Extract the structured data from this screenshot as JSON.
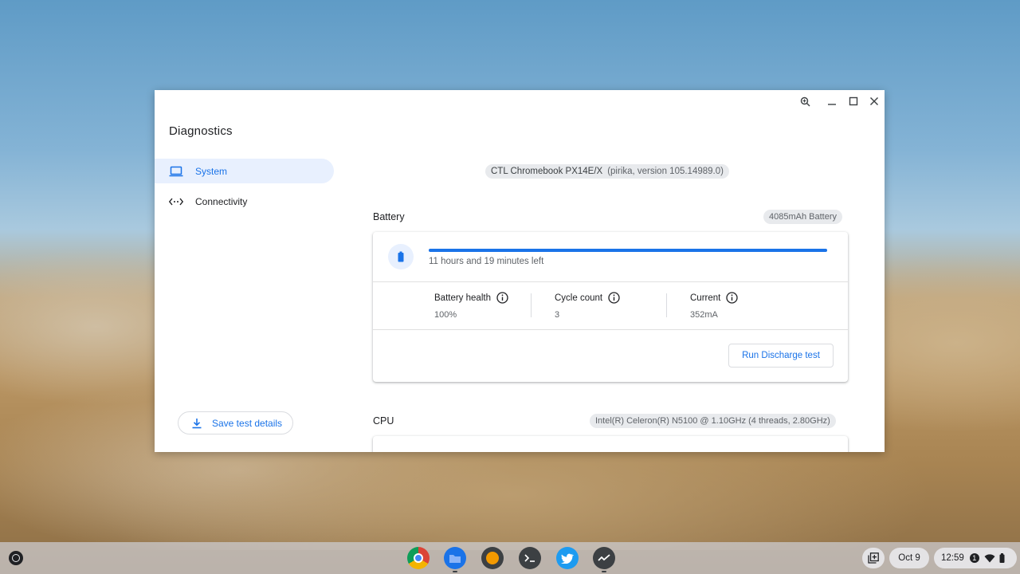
{
  "app": {
    "title": "Diagnostics"
  },
  "sidebar": {
    "items": [
      {
        "label": "System",
        "icon": "laptop-icon",
        "active": true
      },
      {
        "label": "Connectivity",
        "icon": "connectivity-icon",
        "active": false
      }
    ],
    "save_label": "Save test details"
  },
  "device": {
    "name": "CTL Chromebook PX14E/X",
    "version": "(pirika, version 105.14989.0)"
  },
  "battery": {
    "title": "Battery",
    "capacity_chip": "4085mAh Battery",
    "charge_fraction": 1.0,
    "time_left": "11 hours and 19 minutes left",
    "metrics": [
      {
        "label": "Battery health",
        "value": "100%"
      },
      {
        "label": "Cycle count",
        "value": "3"
      },
      {
        "label": "Current",
        "value": "352mA"
      }
    ],
    "run_label": "Run Discharge test"
  },
  "cpu": {
    "title": "CPU",
    "chip": "Intel(R) Celeron(R) N5100 @ 1.10GHz (4 threads, 2.80GHz)"
  },
  "shelf": {
    "apps": [
      "chrome-icon",
      "files-icon",
      "app-icon",
      "terminal-icon",
      "twitter-icon",
      "diagnostics-icon"
    ],
    "date": "Oct 9",
    "time": "12:59",
    "notification_count": "1"
  },
  "colors": {
    "accent": "#1a73e8",
    "active_bg": "#e8f0fe",
    "chip_bg": "#e8eaed"
  }
}
